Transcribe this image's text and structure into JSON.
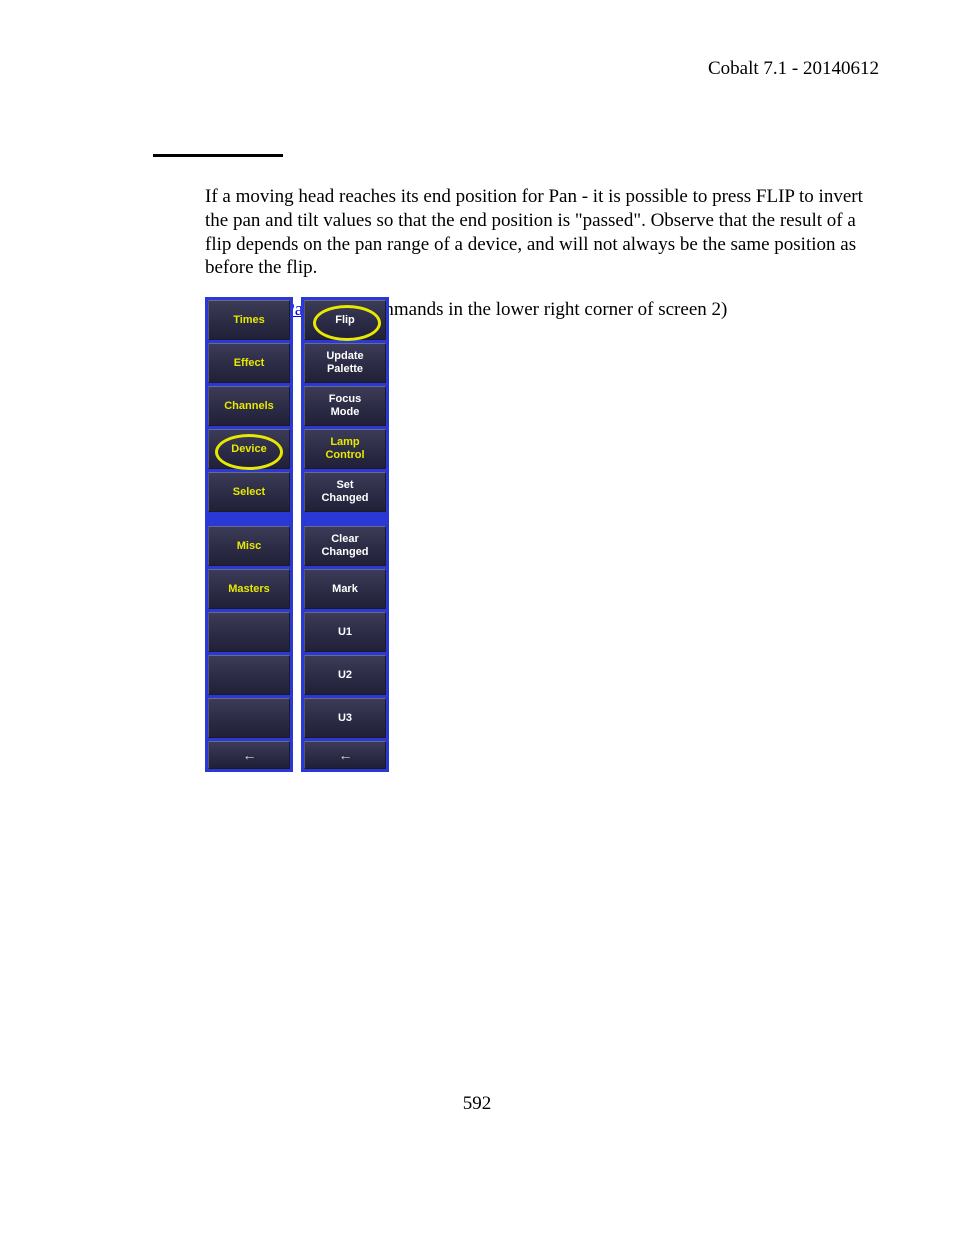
{
  "header": {
    "text": "Cobalt 7.1 - 20140612"
  },
  "body": {
    "para1": "If a moving head reaches its end position for Pan - it is possible to press FLIP to invert the pan and tilt values so that the end position is \"passed\". Observe that the result of a flip depends on the pan range of a device, and will not always be the same position as before the flip.",
    "para2_prefix": "(",
    "para2_link": "Soft Key Pages",
    "para2_suffix": " are commands in the lower right corner of screen 2)"
  },
  "softkeys": {
    "column1": [
      {
        "id": "times",
        "label": "Times",
        "kind": "tab"
      },
      {
        "id": "effect",
        "label": "Effect",
        "kind": "tab"
      },
      {
        "id": "channels",
        "label": "Channels",
        "kind": "tab"
      },
      {
        "id": "device",
        "label": "Device",
        "kind": "tab",
        "highlighted": true
      },
      {
        "id": "select",
        "label": "Select",
        "kind": "tab"
      },
      {
        "id": "spacer1",
        "kind": "spacer"
      },
      {
        "id": "misc",
        "label": "Misc",
        "kind": "tab"
      },
      {
        "id": "masters",
        "label": "Masters",
        "kind": "tab"
      },
      {
        "id": "blank1",
        "label": "",
        "kind": "button"
      },
      {
        "id": "blank2",
        "label": "",
        "kind": "button"
      },
      {
        "id": "blank3",
        "label": "",
        "kind": "button"
      },
      {
        "id": "back1",
        "label": "arrow",
        "kind": "back",
        "short": true
      }
    ],
    "column2": [
      {
        "id": "flip",
        "label": "Flip",
        "kind": "button",
        "highlighted": true
      },
      {
        "id": "update-palette",
        "label": "Update\nPalette",
        "kind": "button"
      },
      {
        "id": "focus-mode",
        "label": "Focus\nMode",
        "kind": "button"
      },
      {
        "id": "lamp-control",
        "label": "Lamp\nControl",
        "kind": "accent"
      },
      {
        "id": "set-changed",
        "label": "Set\nChanged",
        "kind": "button"
      },
      {
        "id": "spacer2",
        "kind": "spacer"
      },
      {
        "id": "clear-changed",
        "label": "Clear\nChanged",
        "kind": "button"
      },
      {
        "id": "mark",
        "label": "Mark",
        "kind": "button"
      },
      {
        "id": "u1",
        "label": "U1",
        "kind": "button"
      },
      {
        "id": "u2",
        "label": "U2",
        "kind": "button"
      },
      {
        "id": "u3",
        "label": "U3",
        "kind": "button"
      },
      {
        "id": "back2",
        "label": "arrow",
        "kind": "back",
        "short": true
      }
    ]
  },
  "pagenum": "592"
}
